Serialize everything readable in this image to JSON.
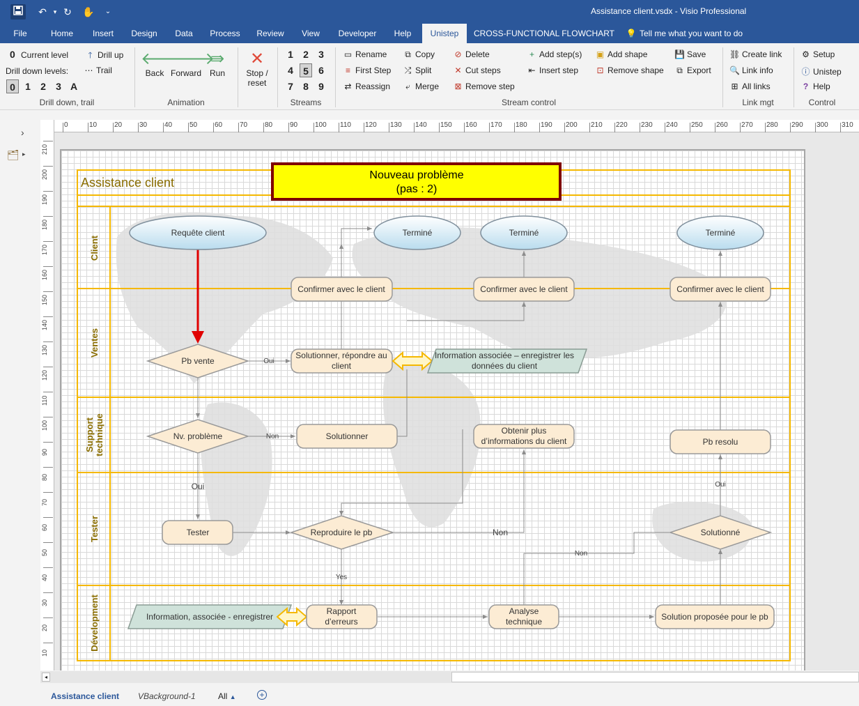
{
  "window": {
    "title": "Assistance client.vsdx  -  Visio Professional"
  },
  "qat": {
    "save_icon": "save-icon",
    "undo_icon": "undo-icon",
    "redo_icon": "redo-icon",
    "touch_icon": "touch-mode-icon"
  },
  "tabs": [
    "File",
    "Home",
    "Insert",
    "Design",
    "Data",
    "Process",
    "Review",
    "View",
    "Developer",
    "Help",
    "Unistep",
    "CROSS-FUNCTIONAL FLOWCHART"
  ],
  "tell_me": "Tell me what you want to do",
  "ribbon": {
    "drill": {
      "current_value": "0",
      "current_label": "Current level",
      "drill_up": "Drill up",
      "levels_label": "Drill down levels:",
      "trail": "Trail",
      "levels": [
        "0",
        "1",
        "2",
        "3",
        "A"
      ],
      "group": "Drill down, trail"
    },
    "animation": {
      "back": "Back",
      "forward": "Forward",
      "run": "Run",
      "group": "Animation"
    },
    "stop": {
      "line1": "Stop /",
      "line2": "reset"
    },
    "streams": {
      "numbers": [
        "1",
        "2",
        "3",
        "4",
        "5",
        "6",
        "7",
        "8",
        "9"
      ],
      "group": "Streams"
    },
    "stream_control": {
      "rename": "Rename",
      "first_step": "First Step",
      "reassign": "Reassign",
      "copy": "Copy",
      "split": "Split",
      "merge": "Merge",
      "delete": "Delete",
      "cut_steps": "Cut steps",
      "remove_step": "Remove step",
      "add_steps": "Add step(s)",
      "insert_step": "Insert step",
      "add_shape": "Add shape",
      "remove_shape": "Remove shape",
      "save": "Save",
      "export": "Export",
      "group": "Stream control"
    },
    "link_mgt": {
      "create_link": "Create link",
      "link_info": "Link info",
      "all_links": "All links",
      "group": "Link mgt"
    },
    "control": {
      "setup": "Setup",
      "unistep": "Unistep",
      "help": "Help",
      "group": "Control"
    }
  },
  "ruler": {
    "h": [
      "0",
      "10",
      "20",
      "30",
      "40",
      "50",
      "60",
      "70",
      "80",
      "90",
      "100",
      "110",
      "120",
      "130",
      "140",
      "150",
      "160",
      "170",
      "180",
      "190",
      "200",
      "210",
      "220",
      "230",
      "240",
      "250",
      "260",
      "270",
      "280",
      "290",
      "300",
      "310"
    ],
    "v": [
      "210",
      "200",
      "190",
      "180",
      "170",
      "160",
      "150",
      "140",
      "130",
      "120",
      "110",
      "100",
      "90",
      "80",
      "70",
      "60",
      "50",
      "40",
      "30",
      "20",
      "10"
    ]
  },
  "diagram": {
    "title": "Assistance client",
    "banner": {
      "line1": "Nouveau problème",
      "line2": "(pas : 2)"
    },
    "lanes": [
      "Client",
      "Ventes",
      "Support technique",
      "Tester",
      "Dévelopment"
    ],
    "shapes": {
      "requete": "Requête client",
      "termine1": "Terminé",
      "termine2": "Terminé",
      "termine3": "Terminé",
      "confirmer1": "Confirmer avec le client",
      "confirmer2": "Confirmer avec le client",
      "confirmer3": "Confirmer avec le client",
      "pb_vente": "Pb vente",
      "solutionner_rep_1": "Solutionner, répondre au",
      "solutionner_rep_2": "client",
      "info_assoc_1": "Information associée – enregistrer les",
      "info_assoc_2": "données du client",
      "nv_probleme": "Nv. problème",
      "solutionner": "Solutionner",
      "obtenir_1": "Obtenir plus",
      "obtenir_2": "d’informations du client",
      "pb_resolu": "Pb resolu",
      "tester": "Tester",
      "reproduire": "Reproduire le pb",
      "solutionne": "Solutionné",
      "info_dev": "Information, associée - enregistrer",
      "rapport_1": "Rapport",
      "rapport_2": "d’erreurs",
      "analyse_1": "Analyse",
      "analyse_2": "technique",
      "solution_proposee": "Solution proposée pour le pb"
    },
    "connector_labels": {
      "oui1": "Oui",
      "non1": "Non",
      "oui2": "Oui",
      "non2": "Non",
      "yes": "Yes",
      "non3": "Non",
      "oui3": "Oui"
    }
  },
  "sheets": {
    "active": "Assistance client",
    "background": "VBackground-1",
    "all": "All"
  },
  "colors": {
    "accent": "#2b579a",
    "lane_border": "#f5b800",
    "banner_fill": "#ffff00",
    "banner_border": "#7f0000",
    "highlight_arrow": "#e00000"
  }
}
